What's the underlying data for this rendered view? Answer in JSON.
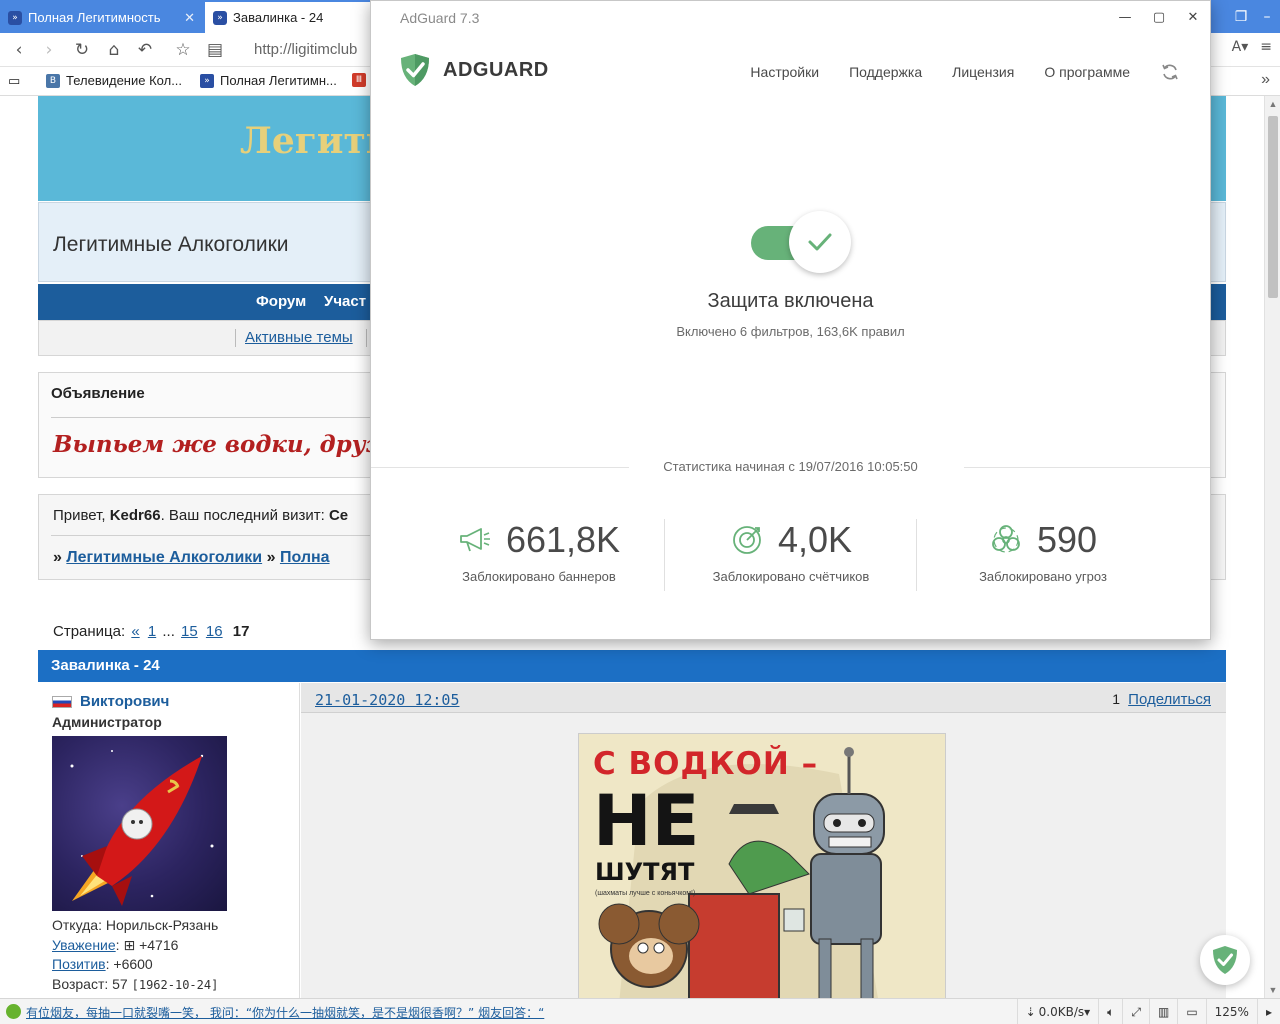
{
  "browser": {
    "tabs": [
      {
        "title": "Полная Легитимность"
      },
      {
        "title": "Завалинка - 24"
      }
    ],
    "url": "http://ligitimclub",
    "bookmarks": [
      {
        "label": "Телевидение Кол..."
      },
      {
        "label": "Полная Легитимн..."
      }
    ]
  },
  "site": {
    "banner_title": "Легити",
    "name": "Легитимные Алкоголики",
    "nav": [
      "Форум",
      "Участ"
    ],
    "subnav_link": "Активные темы",
    "announcement": {
      "title": "Объявление",
      "text": "Выпьем же водки, друзья!"
    },
    "greeting": {
      "hello": "Привет,",
      "user": "Kedr66",
      "last_visit": ". Ваш последний визит:",
      "last_visit_value": "Се",
      "crumb1": "Легитимные Алкоголики",
      "crumb2": "Полна"
    },
    "pager": {
      "label": "Страница:",
      "prev": "«",
      "p1": "1",
      "ellipsis": "...",
      "p15": "15",
      "p16": "16",
      "current": "17"
    },
    "topic_title": "Завалинка - 24",
    "post": {
      "author": "Викторович",
      "role": "Администратор",
      "from": "Откуда: Норильск-Рязань",
      "respect_label": "Уважение",
      "respect_value": ": ⊞ +4716",
      "positive_label": "Позитив",
      "positive_value": ": +6600",
      "age_label": "Возраст: 57",
      "age_value": "[1962-10-24]",
      "date": "21-01-2020 12:05",
      "number": "1",
      "share": "Поделиться",
      "poster_line1": "С ВОДКОЙ –",
      "poster_line2": "НЕ",
      "poster_line3": "ШУТЯТ",
      "poster_small": "(шахматы лучше с коньячком!)"
    }
  },
  "statusbar": {
    "link_text": "有位烟友，每抽一口就裂嘴一笑， 我问：“你为什么一抽烟就笑，是不是烟很香啊？” 烟友回答：“",
    "speed": "0.0KB/s",
    "zoom": "125%"
  },
  "adguard": {
    "window_title": "AdGuard 7.3",
    "logo_text": "ADGUARD",
    "menu": [
      "Настройки",
      "Поддержка",
      "Лицензия",
      "О программе"
    ],
    "protection_title": "Защита включена",
    "protection_subtitle": "Включено 6 фильтров, 163,6K правил",
    "stats_since": "Статистика начиная с 19/07/2016 10:05:50",
    "protection_enabled": true,
    "stats": [
      {
        "value": "661,8K",
        "label": "Заблокировано баннеров",
        "icon": "megaphone-icon"
      },
      {
        "value": "4,0K",
        "label": "Заблокировано счётчиков",
        "icon": "target-icon"
      },
      {
        "value": "590",
        "label": "Заблокировано угроз",
        "icon": "biohazard-icon"
      }
    ],
    "accent_color": "#67b279"
  }
}
